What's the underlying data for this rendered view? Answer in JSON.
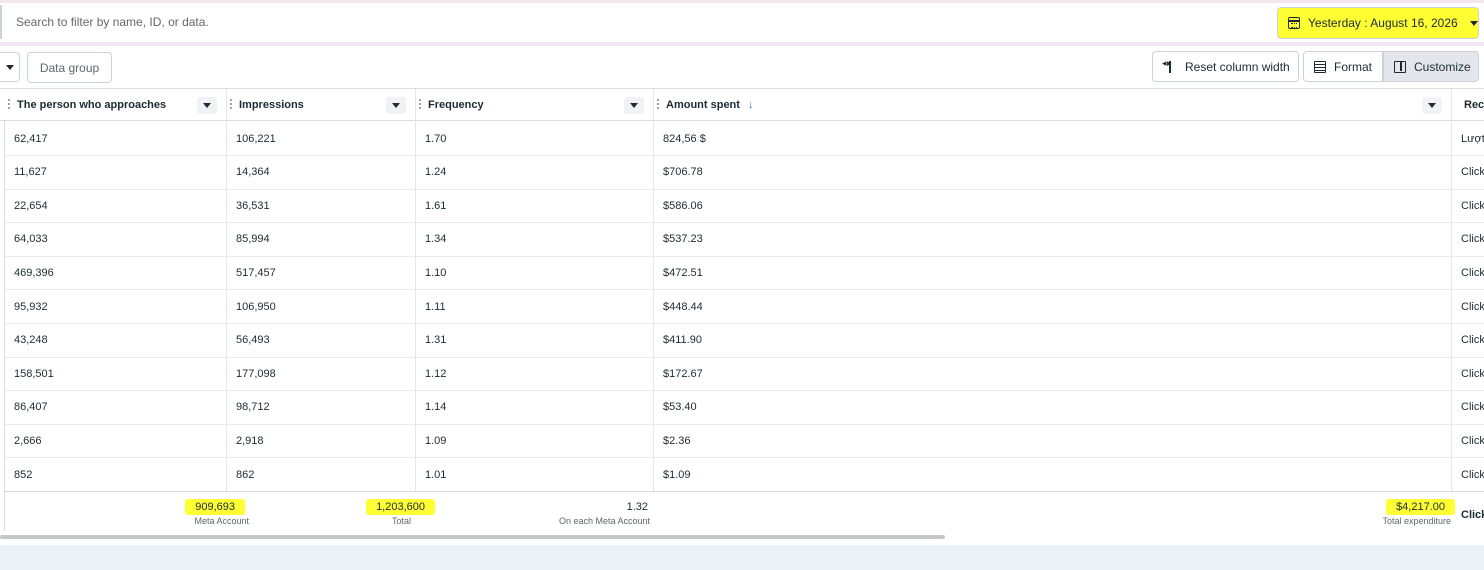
{
  "search": {
    "placeholder": "Search to filter by name, ID, or data."
  },
  "date_range": {
    "label": "Yesterday : August 16, 2026",
    "highlight": "#ffff33"
  },
  "toolbar": {
    "data_group": "Data group",
    "reset_column_width": "Reset column width",
    "format": "Format",
    "customize": "Customize"
  },
  "columns": [
    {
      "label": "The person who approaches"
    },
    {
      "label": "Impressions"
    },
    {
      "label": "Frequency"
    },
    {
      "label": "Amount spent",
      "sorted": "descending"
    },
    {
      "label": "Rec"
    }
  ],
  "rows": [
    {
      "reach": "62,417",
      "impressions": "106,221",
      "frequency": "1.70",
      "amount": "824,56 $",
      "result": "Lượt"
    },
    {
      "reach": "11,627",
      "impressions": "14,364",
      "frequency": "1.24",
      "amount": "$706.78",
      "result": "Click"
    },
    {
      "reach": "22,654",
      "impressions": "36,531",
      "frequency": "1.61",
      "amount": "$586.06",
      "result": "Click"
    },
    {
      "reach": "64,033",
      "impressions": "85,994",
      "frequency": "1.34",
      "amount": "$537.23",
      "result": "Click"
    },
    {
      "reach": "469,396",
      "impressions": "517,457",
      "frequency": "1.10",
      "amount": "$472.51",
      "result": "Click"
    },
    {
      "reach": "95,932",
      "impressions": "106,950",
      "frequency": "1.11",
      "amount": "$448.44",
      "result": "Click"
    },
    {
      "reach": "43,248",
      "impressions": "56,493",
      "frequency": "1.31",
      "amount": "$411.90",
      "result": "Click"
    },
    {
      "reach": "158,501",
      "impressions": "177,098",
      "frequency": "1.12",
      "amount": "$172.67",
      "result": "Click"
    },
    {
      "reach": "86,407",
      "impressions": "98,712",
      "frequency": "1.14",
      "amount": "$53.40",
      "result": "Click"
    },
    {
      "reach": "2,666",
      "impressions": "2,918",
      "frequency": "1.09",
      "amount": "$2.36",
      "result": "Click"
    },
    {
      "reach": "852",
      "impressions": "862",
      "frequency": "1.01",
      "amount": "$1.09",
      "result": "Click"
    }
  ],
  "totals": {
    "reach": {
      "value": "909,693",
      "label": "Meta Account"
    },
    "impressions": {
      "value": "1,203,600",
      "label": "Total"
    },
    "frequency": {
      "value": "1.32",
      "label": "On each Meta Account"
    },
    "amount": {
      "value": "$4,217.00",
      "label": "Total expenditure"
    },
    "result": {
      "value": "Click"
    }
  }
}
